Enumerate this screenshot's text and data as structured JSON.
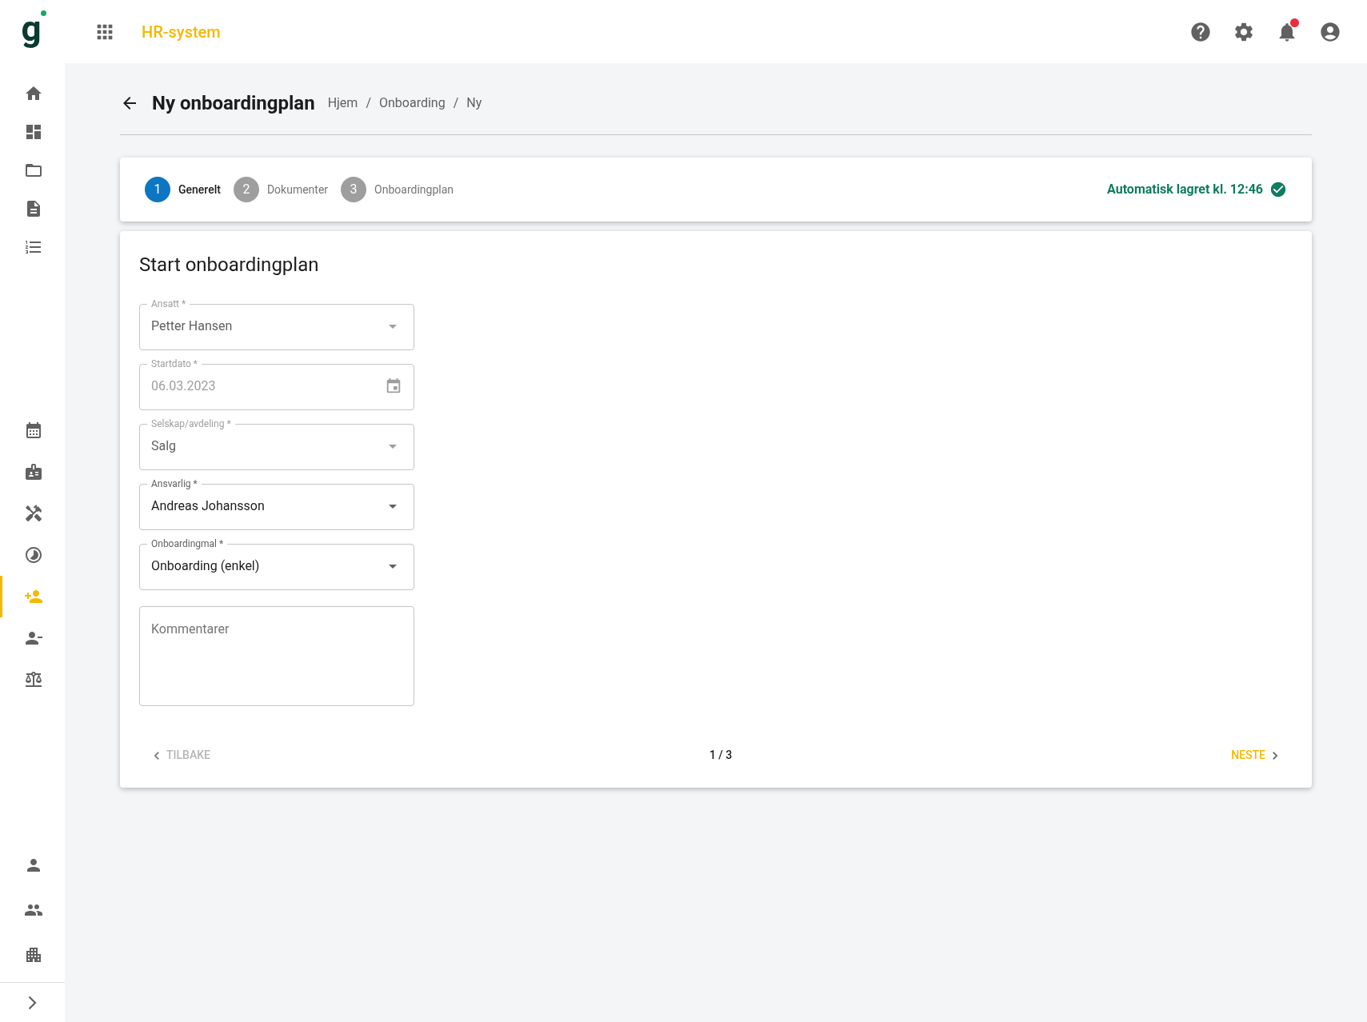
{
  "logo": {
    "letter": "g"
  },
  "app_title": "HR-system",
  "header_icons": {
    "notifications": {
      "unread": true
    }
  },
  "sidebar": {
    "groups": [
      [
        {
          "selected": false
        },
        {
          "selected": false
        },
        {
          "selected": false
        },
        {
          "selected": false
        },
        {
          "selected": false
        }
      ],
      [
        {
          "selected": false
        },
        {
          "selected": false
        },
        {
          "selected": false
        },
        {
          "selected": false
        },
        {
          "selected": true
        },
        {
          "selected": false
        },
        {
          "selected": false
        }
      ],
      [
        {
          "selected": false
        },
        {
          "selected": false
        },
        {
          "selected": false
        }
      ]
    ]
  },
  "page": {
    "title": "Ny onboardingplan",
    "breadcrumbs": [
      "Hjem",
      "Onboarding",
      "Ny"
    ],
    "separator": "/"
  },
  "stepper": {
    "steps": [
      {
        "number": "1",
        "label": "Generelt",
        "selected": true
      },
      {
        "number": "2",
        "label": "Dokumenter",
        "selected": false
      },
      {
        "number": "3",
        "label": "Onboardingplan",
        "selected": false
      }
    ],
    "autosave": "Automatisk lagret kl. 12:46"
  },
  "form": {
    "title": "Start onboardingplan",
    "fields": [
      {
        "kind": "select",
        "label": "Ansatt *",
        "value": "Petter Hansen",
        "disabled": true
      },
      {
        "kind": "date",
        "label": "Startdato *",
        "value": "06.03.2023",
        "disabled": true
      },
      {
        "kind": "select",
        "label": "Selskap/avdeling *",
        "value": "Salg",
        "disabled": true
      },
      {
        "kind": "select",
        "label": "Ansvarlig *",
        "value": "Andreas Johansson",
        "disabled": false
      },
      {
        "kind": "select",
        "label": "Onboardingmal *",
        "value": "Onboarding (enkel)",
        "disabled": false
      },
      {
        "kind": "textarea",
        "placeholder": "Kommentarer"
      }
    ]
  },
  "pager": {
    "back": {
      "label": "TILBAKE",
      "disabled": true
    },
    "position": "1 / 3",
    "next": {
      "label": "NESTE",
      "disabled": false
    }
  }
}
